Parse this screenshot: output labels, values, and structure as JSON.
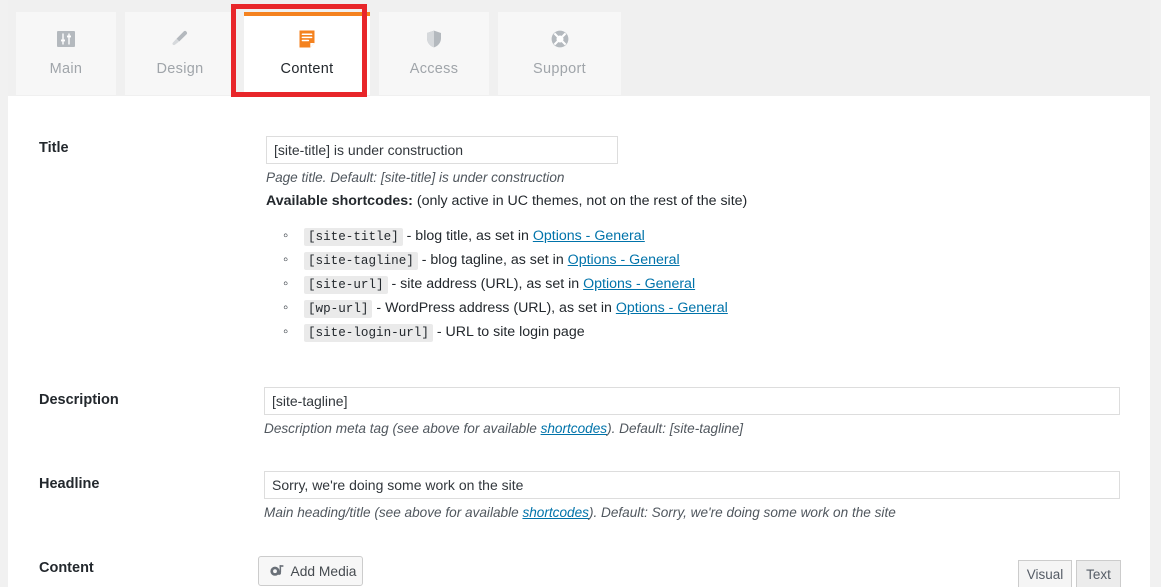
{
  "tabs": [
    {
      "id": "main",
      "label": "Main",
      "icon": "sliders-icon",
      "active": false
    },
    {
      "id": "design",
      "label": "Design",
      "icon": "paintbrush-icon",
      "active": false
    },
    {
      "id": "content",
      "label": "Content",
      "icon": "document-icon",
      "active": true
    },
    {
      "id": "access",
      "label": "Access",
      "icon": "shield-icon",
      "active": false
    },
    {
      "id": "support",
      "label": "Support",
      "icon": "lifebuoy-icon",
      "active": false
    }
  ],
  "annotation": {
    "target": "content-tab",
    "color": "#e8262a"
  },
  "colors": {
    "accent_orange": "#f4821f",
    "link_blue": "#0073aa",
    "annotation_red": "#e8262a",
    "header_bg": "#f0f0f0",
    "tab_bg": "#f7f7f7"
  },
  "fields": {
    "title": {
      "label": "Title",
      "value": "[site-title] is under construction",
      "placeholder": "[site-title] is under construction",
      "helper": "Page title. Default: [site-title] is under construction"
    },
    "description": {
      "label": "Description",
      "value": "[site-tagline]",
      "placeholder": "[site-tagline]",
      "helper_prefix": "Description meta tag (see above for available ",
      "helper_link": "shortcodes",
      "helper_suffix": "). Default: [site-tagline]"
    },
    "headline": {
      "label": "Headline",
      "value": "Sorry, we're doing some work on the site",
      "placeholder": "Sorry, we're doing some work on the site",
      "helper_prefix": "Main heading/title (see above for available ",
      "helper_link": "shortcodes",
      "helper_suffix": "). Default: Sorry, we're doing some work on the site"
    },
    "content": {
      "label": "Content"
    }
  },
  "shortcodes_section": {
    "heading_bold": "Available shortcodes:",
    "heading_rest": " (only active in UC themes, not on the rest of the site)",
    "items": [
      {
        "code": "[site-title]",
        "desc_before": " - blog title, as set in ",
        "link": "Options - General",
        "desc_after": ""
      },
      {
        "code": "[site-tagline]",
        "desc_before": " - blog tagline, as set in ",
        "link": "Options - General",
        "desc_after": ""
      },
      {
        "code": "[site-url]",
        "desc_before": " - site address (URL), as set in ",
        "link": "Options - General",
        "desc_after": ""
      },
      {
        "code": "[wp-url]",
        "desc_before": " - WordPress address (URL), as set in ",
        "link": "Options - General",
        "desc_after": ""
      },
      {
        "code": "[site-login-url]",
        "desc_before": " - URL to site login page",
        "link": "",
        "desc_after": ""
      }
    ]
  },
  "editor": {
    "add_media_label": "Add Media",
    "add_media_icon": "media-icon",
    "tab_visual": "Visual",
    "tab_text": "Text"
  }
}
